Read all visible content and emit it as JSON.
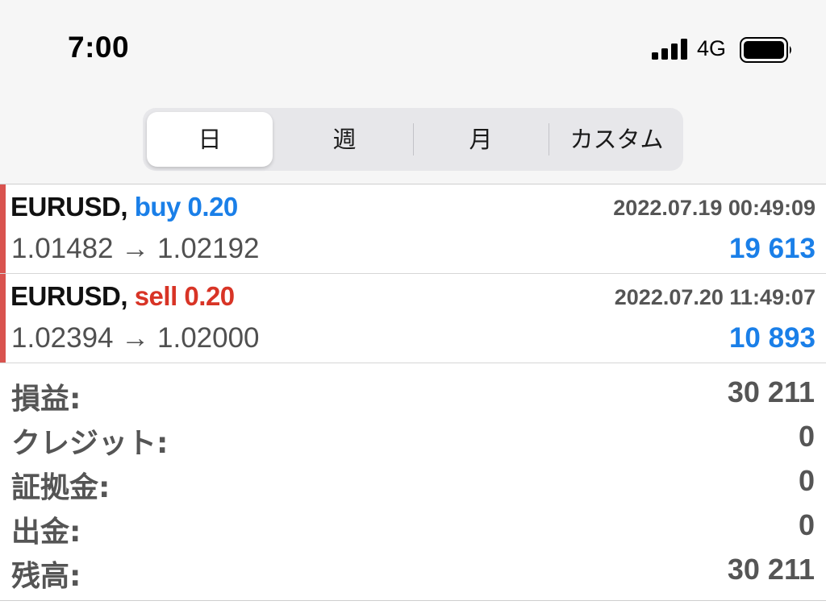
{
  "status_bar": {
    "time": "7:00",
    "network": "4G"
  },
  "period_tabs": {
    "items": [
      "日",
      "週",
      "月",
      "カスタム"
    ],
    "selected": "日"
  },
  "trades": [
    {
      "symbol": "EURUSD,",
      "type": "buy",
      "volume": "0.20",
      "time": "2022.07.19 00:49:09",
      "open_price": "1.01482",
      "arrow": "→",
      "close_price": "1.02192",
      "profit": "19 613"
    },
    {
      "symbol": "EURUSD,",
      "type": "sell",
      "volume": "0.20",
      "time": "2022.07.20 11:49:07",
      "open_price": "1.02394",
      "arrow": "→",
      "close_price": "1.02000",
      "profit": "10 893"
    }
  ],
  "summary": [
    {
      "label": "損益:",
      "value": "30 211"
    },
    {
      "label": "クレジット:",
      "value": "0"
    },
    {
      "label": "証拠金:",
      "value": "0"
    },
    {
      "label": "出金:",
      "value": "0"
    },
    {
      "label": "残高:",
      "value": "30 211"
    }
  ],
  "colors": {
    "buy": "#1a7fe8",
    "sell": "#d83426",
    "accent": "#d9534f",
    "profit": "#1a7fe8"
  }
}
